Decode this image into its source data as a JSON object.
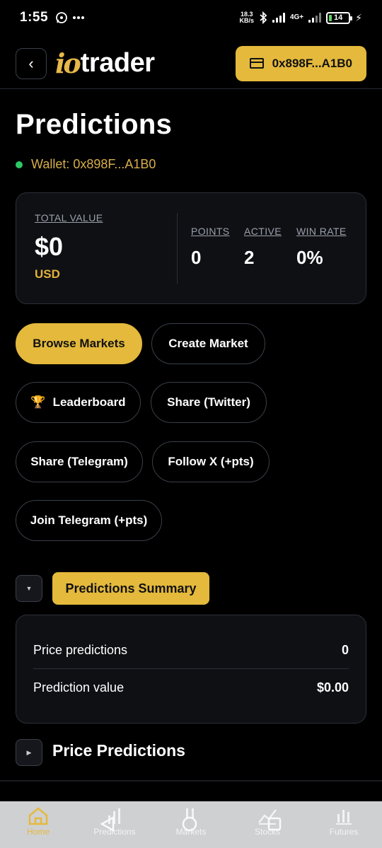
{
  "status": {
    "time": "1:55",
    "netspeed_value": "18.3",
    "netspeed_unit": "KB/s",
    "net_type": "4G+",
    "battery": "14",
    "battery_fraction": 0.14
  },
  "header": {
    "logo_mark": "io",
    "logo_text": "trader",
    "wallet_label": "0x898F...A1B0"
  },
  "page": {
    "title": "Predictions",
    "wallet_prefix": "Wallet:",
    "wallet_address": "0x898F...A1B0"
  },
  "summary": {
    "total_label": "TOTAL VALUE",
    "total_value": "$0",
    "currency": "USD",
    "stats": [
      {
        "label": "POINTS",
        "value": "0"
      },
      {
        "label": "ACTIVE",
        "value": "2"
      },
      {
        "label": "WIN RATE",
        "value": "0%"
      }
    ]
  },
  "actions": {
    "browse": "Browse Markets",
    "create": "Create Market",
    "leaderboard": "Leaderboard",
    "share_twitter": "Share (Twitter)",
    "share_telegram": "Share (Telegram)",
    "follow_x": "Follow X (+pts)",
    "join_telegram": "Join Telegram (+pts)"
  },
  "predictions_summary": {
    "toggle_label": "Predictions Summary",
    "rows": [
      {
        "label": "Price predictions",
        "value": "0"
      },
      {
        "label": "Prediction value",
        "value": "$0.00"
      }
    ]
  },
  "price_predictions": {
    "title": "Price Predictions"
  },
  "nav": {
    "items": [
      {
        "label": "Home"
      },
      {
        "label": "Predictions"
      },
      {
        "label": "Markets"
      },
      {
        "label": "Stocks"
      },
      {
        "label": "Futures"
      }
    ]
  },
  "colors": {
    "accent": "#e4b93c",
    "online": "#2ec866",
    "background": "#000000"
  }
}
